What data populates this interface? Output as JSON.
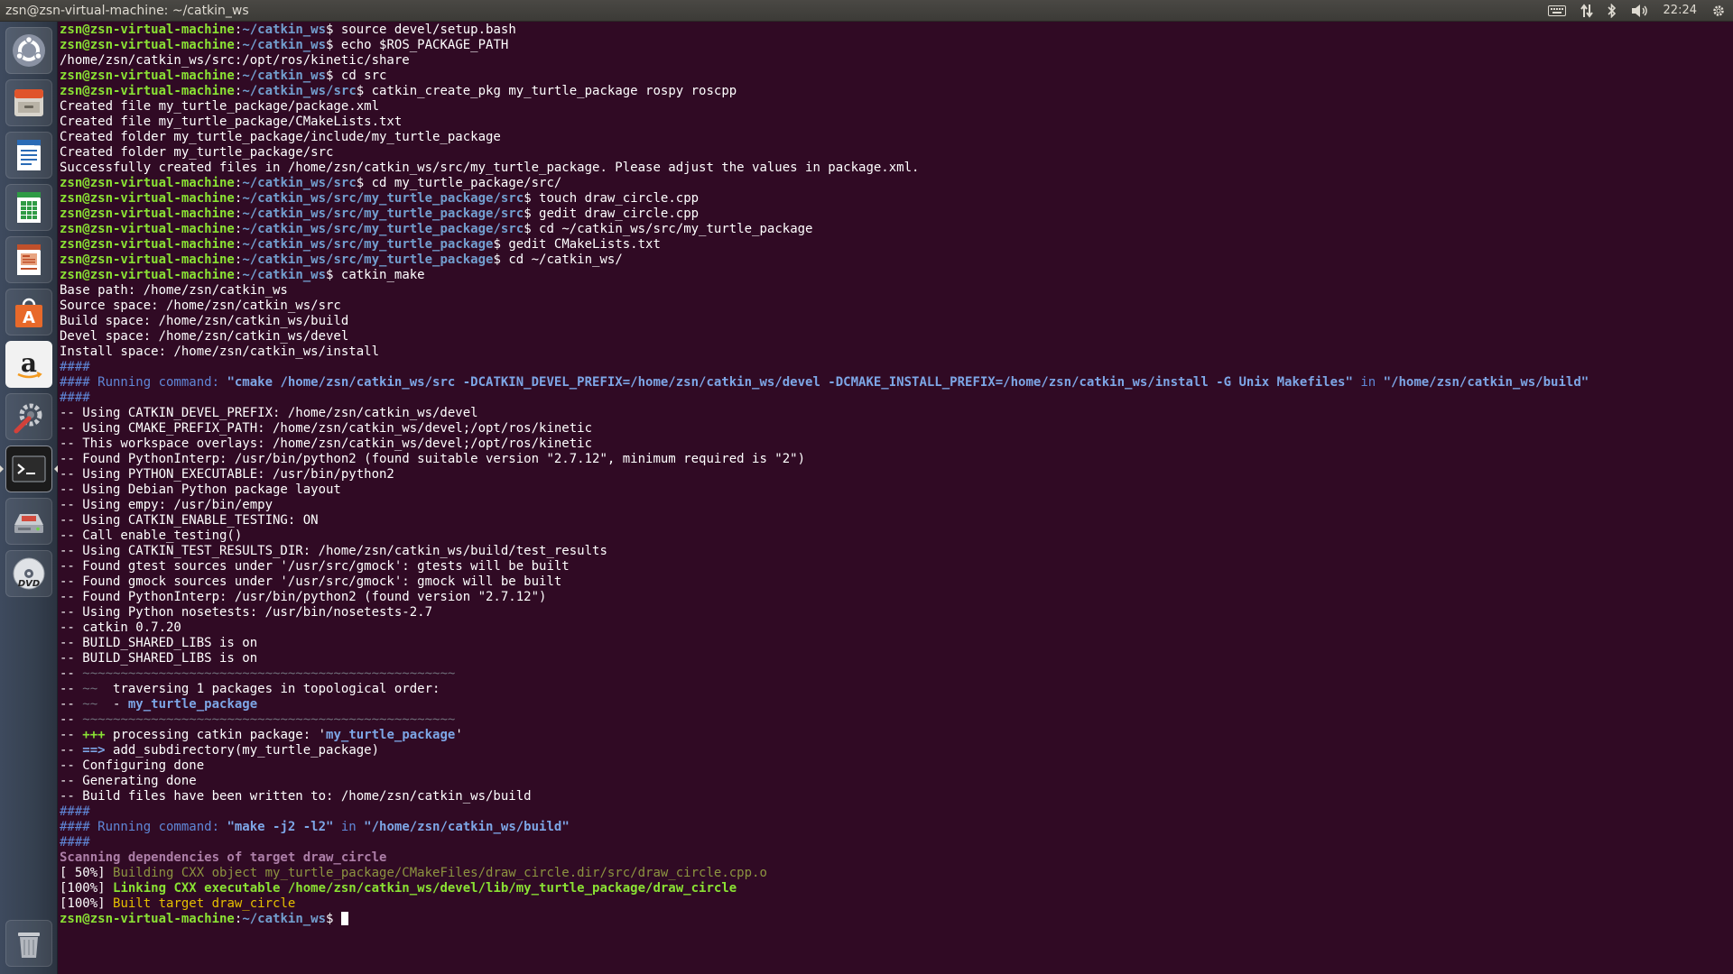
{
  "window": {
    "title": "zsn@zsn-virtual-machine: ~/catkin_ws"
  },
  "tray": {
    "icons": [
      "keyboard-icon",
      "network-icon",
      "bluetooth-icon",
      "volume-icon",
      "gear-icon"
    ],
    "clock": "22:24"
  },
  "launcher": {
    "items": [
      {
        "name": "dash-home",
        "icon": "ubuntu-logo-icon"
      },
      {
        "name": "files",
        "icon": "file-cabinet-icon"
      },
      {
        "name": "libreoffice-writer",
        "icon": "writer-document-icon"
      },
      {
        "name": "libreoffice-calc",
        "icon": "spreadsheet-icon"
      },
      {
        "name": "libreoffice-impress",
        "icon": "presentation-icon"
      },
      {
        "name": "ubuntu-software",
        "icon": "software-bag-icon"
      },
      {
        "name": "amazon",
        "icon": "amazon-icon"
      },
      {
        "name": "system-settings",
        "icon": "settings-tools-icon"
      },
      {
        "name": "terminal",
        "icon": "terminal-icon",
        "active": true
      },
      {
        "name": "disk-drive",
        "icon": "hard-drive-icon"
      },
      {
        "name": "dvd",
        "icon": "dvd-icon"
      },
      {
        "name": "trash",
        "icon": "trash-icon"
      }
    ]
  },
  "colors": {
    "background": "#300a24",
    "prompt_user": "#8ae234",
    "prompt_path": "#729fcf",
    "text": "#ffffff"
  },
  "terminal": {
    "lines": [
      [
        {
          "t": "zsn@zsn-virtual-machine",
          "c": "prompt-user"
        },
        {
          "t": ":",
          "c": ""
        },
        {
          "t": "~/catkin_ws",
          "c": "prompt-path"
        },
        {
          "t": "$ source devel/setup.bash",
          "c": ""
        }
      ],
      [
        {
          "t": "zsn@zsn-virtual-machine",
          "c": "prompt-user"
        },
        {
          "t": ":",
          "c": ""
        },
        {
          "t": "~/catkin_ws",
          "c": "prompt-path"
        },
        {
          "t": "$ echo $ROS_PACKAGE_PATH",
          "c": ""
        }
      ],
      [
        {
          "t": "/home/zsn/catkin_ws/src:/opt/ros/kinetic/share",
          "c": ""
        }
      ],
      [
        {
          "t": "zsn@zsn-virtual-machine",
          "c": "prompt-user"
        },
        {
          "t": ":",
          "c": ""
        },
        {
          "t": "~/catkin_ws",
          "c": "prompt-path"
        },
        {
          "t": "$ cd src",
          "c": ""
        }
      ],
      [
        {
          "t": "zsn@zsn-virtual-machine",
          "c": "prompt-user"
        },
        {
          "t": ":",
          "c": ""
        },
        {
          "t": "~/catkin_ws/src",
          "c": "prompt-path"
        },
        {
          "t": "$ catkin_create_pkg my_turtle_package rospy roscpp",
          "c": ""
        }
      ],
      [
        {
          "t": "Created file my_turtle_package/package.xml",
          "c": ""
        }
      ],
      [
        {
          "t": "Created file my_turtle_package/CMakeLists.txt",
          "c": ""
        }
      ],
      [
        {
          "t": "Created folder my_turtle_package/include/my_turtle_package",
          "c": ""
        }
      ],
      [
        {
          "t": "Created folder my_turtle_package/src",
          "c": ""
        }
      ],
      [
        {
          "t": "Successfully created files in /home/zsn/catkin_ws/src/my_turtle_package. Please adjust the values in package.xml.",
          "c": ""
        }
      ],
      [
        {
          "t": "zsn@zsn-virtual-machine",
          "c": "prompt-user"
        },
        {
          "t": ":",
          "c": ""
        },
        {
          "t": "~/catkin_ws/src",
          "c": "prompt-path"
        },
        {
          "t": "$ cd my_turtle_package/src/",
          "c": ""
        }
      ],
      [
        {
          "t": "zsn@zsn-virtual-machine",
          "c": "prompt-user"
        },
        {
          "t": ":",
          "c": ""
        },
        {
          "t": "~/catkin_ws/src/my_turtle_package/src",
          "c": "prompt-path"
        },
        {
          "t": "$ touch draw_circle.cpp",
          "c": ""
        }
      ],
      [
        {
          "t": "zsn@zsn-virtual-machine",
          "c": "prompt-user"
        },
        {
          "t": ":",
          "c": ""
        },
        {
          "t": "~/catkin_ws/src/my_turtle_package/src",
          "c": "prompt-path"
        },
        {
          "t": "$ gedit draw_circle.cpp",
          "c": ""
        }
      ],
      [
        {
          "t": "zsn@zsn-virtual-machine",
          "c": "prompt-user"
        },
        {
          "t": ":",
          "c": ""
        },
        {
          "t": "~/catkin_ws/src/my_turtle_package/src",
          "c": "prompt-path"
        },
        {
          "t": "$ cd ~/catkin_ws/src/my_turtle_package",
          "c": ""
        }
      ],
      [
        {
          "t": "zsn@zsn-virtual-machine",
          "c": "prompt-user"
        },
        {
          "t": ":",
          "c": ""
        },
        {
          "t": "~/catkin_ws/src/my_turtle_package",
          "c": "prompt-path"
        },
        {
          "t": "$ gedit CMakeLists.txt",
          "c": ""
        }
      ],
      [
        {
          "t": "zsn@zsn-virtual-machine",
          "c": "prompt-user"
        },
        {
          "t": ":",
          "c": ""
        },
        {
          "t": "~/catkin_ws/src/my_turtle_package",
          "c": "prompt-path"
        },
        {
          "t": "$ cd ~/catkin_ws/",
          "c": ""
        }
      ],
      [
        {
          "t": "zsn@zsn-virtual-machine",
          "c": "prompt-user"
        },
        {
          "t": ":",
          "c": ""
        },
        {
          "t": "~/catkin_ws",
          "c": "prompt-path"
        },
        {
          "t": "$ catkin_make",
          "c": ""
        }
      ],
      [
        {
          "t": "Base path: /home/zsn/catkin_ws",
          "c": ""
        }
      ],
      [
        {
          "t": "Source space: /home/zsn/catkin_ws/src",
          "c": ""
        }
      ],
      [
        {
          "t": "Build space: /home/zsn/catkin_ws/build",
          "c": ""
        }
      ],
      [
        {
          "t": "Devel space: /home/zsn/catkin_ws/devel",
          "c": ""
        }
      ],
      [
        {
          "t": "Install space: /home/zsn/catkin_ws/install",
          "c": ""
        }
      ],
      [
        {
          "t": "####",
          "c": "c-blue"
        }
      ],
      [
        {
          "t": "#### Running command: ",
          "c": "c-blue"
        },
        {
          "t": "\"cmake /home/zsn/catkin_ws/src -DCATKIN_DEVEL_PREFIX=/home/zsn/catkin_ws/devel -DCMAKE_INSTALL_PREFIX=/home/zsn/catkin_ws/install -G Unix Makefiles\"",
          "c": "c-blue-b"
        },
        {
          "t": " in ",
          "c": "c-blue"
        },
        {
          "t": "\"/home/zsn/catkin_ws/build\"",
          "c": "c-blue-b"
        }
      ],
      [
        {
          "t": "####",
          "c": "c-blue"
        }
      ],
      [
        {
          "t": "-- Using CATKIN_DEVEL_PREFIX: /home/zsn/catkin_ws/devel",
          "c": ""
        }
      ],
      [
        {
          "t": "-- Using CMAKE_PREFIX_PATH: /home/zsn/catkin_ws/devel;/opt/ros/kinetic",
          "c": ""
        }
      ],
      [
        {
          "t": "-- This workspace overlays: /home/zsn/catkin_ws/devel;/opt/ros/kinetic",
          "c": ""
        }
      ],
      [
        {
          "t": "-- Found PythonInterp: /usr/bin/python2 (found suitable version \"2.7.12\", minimum required is \"2\")",
          "c": ""
        }
      ],
      [
        {
          "t": "-- Using PYTHON_EXECUTABLE: /usr/bin/python2",
          "c": ""
        }
      ],
      [
        {
          "t": "-- Using Debian Python package layout",
          "c": ""
        }
      ],
      [
        {
          "t": "-- Using empy: /usr/bin/empy",
          "c": ""
        }
      ],
      [
        {
          "t": "-- Using CATKIN_ENABLE_TESTING: ON",
          "c": ""
        }
      ],
      [
        {
          "t": "-- Call enable_testing()",
          "c": ""
        }
      ],
      [
        {
          "t": "-- Using CATKIN_TEST_RESULTS_DIR: /home/zsn/catkin_ws/build/test_results",
          "c": ""
        }
      ],
      [
        {
          "t": "-- Found gtest sources under '/usr/src/gmock': gtests will be built",
          "c": ""
        }
      ],
      [
        {
          "t": "-- Found gmock sources under '/usr/src/gmock': gmock will be built",
          "c": ""
        }
      ],
      [
        {
          "t": "-- Found PythonInterp: /usr/bin/python2 (found version \"2.7.12\")",
          "c": ""
        }
      ],
      [
        {
          "t": "-- Using Python nosetests: /usr/bin/nosetests-2.7",
          "c": ""
        }
      ],
      [
        {
          "t": "-- catkin 0.7.20",
          "c": ""
        }
      ],
      [
        {
          "t": "-- BUILD_SHARED_LIBS is on",
          "c": ""
        }
      ],
      [
        {
          "t": "-- BUILD_SHARED_LIBS is on",
          "c": ""
        }
      ],
      [
        {
          "t": "-- ",
          "c": ""
        },
        {
          "t": "~~~~~~~~~~~~~~~~~~~~~~~~~~~~~~~~~~~~~~~~~~~~~~~~~",
          "c": "c-gray"
        }
      ],
      [
        {
          "t": "-- ",
          "c": ""
        },
        {
          "t": "~~",
          "c": "c-gray"
        },
        {
          "t": "  traversing 1 packages in topological order:",
          "c": ""
        }
      ],
      [
        {
          "t": "-- ",
          "c": ""
        },
        {
          "t": "~~",
          "c": "c-gray"
        },
        {
          "t": "  - ",
          "c": ""
        },
        {
          "t": "my_turtle_package",
          "c": "c-blue-b"
        }
      ],
      [
        {
          "t": "-- ",
          "c": ""
        },
        {
          "t": "~~~~~~~~~~~~~~~~~~~~~~~~~~~~~~~~~~~~~~~~~~~~~~~~~",
          "c": "c-gray"
        }
      ],
      [
        {
          "t": "-- ",
          "c": ""
        },
        {
          "t": "+++",
          "c": "c-green-b"
        },
        {
          "t": " processing catkin package: '",
          "c": ""
        },
        {
          "t": "my_turtle_package",
          "c": "c-blue-b"
        },
        {
          "t": "'",
          "c": ""
        }
      ],
      [
        {
          "t": "-- ",
          "c": ""
        },
        {
          "t": "==>",
          "c": "c-blue-b"
        },
        {
          "t": " add_subdirectory(my_turtle_package)",
          "c": ""
        }
      ],
      [
        {
          "t": "-- Configuring done",
          "c": ""
        }
      ],
      [
        {
          "t": "-- Generating done",
          "c": ""
        }
      ],
      [
        {
          "t": "-- Build files have been written to: /home/zsn/catkin_ws/build",
          "c": ""
        }
      ],
      [
        {
          "t": "####",
          "c": "c-blue"
        }
      ],
      [
        {
          "t": "#### Running command: ",
          "c": "c-blue"
        },
        {
          "t": "\"make -j2 -l2\"",
          "c": "c-blue-b"
        },
        {
          "t": " in ",
          "c": "c-blue"
        },
        {
          "t": "\"/home/zsn/catkin_ws/build\"",
          "c": "c-blue-b"
        }
      ],
      [
        {
          "t": "####",
          "c": "c-blue"
        }
      ],
      [
        {
          "t": "Scanning dependencies of target draw_circle",
          "c": "c-purple-b"
        }
      ],
      [
        {
          "t": "[ 50%] ",
          "c": ""
        },
        {
          "t": "Building CXX object my_turtle_package/CMakeFiles/draw_circle.dir/src/draw_circle.cpp.o",
          "c": "c-olive"
        }
      ],
      [
        {
          "t": "[100%] ",
          "c": ""
        },
        {
          "t": "Linking CXX executable /home/zsn/catkin_ws/devel/lib/my_turtle_package/draw_circle",
          "c": "c-lime-b"
        }
      ],
      [
        {
          "t": "[100%] ",
          "c": ""
        },
        {
          "t": "Built target draw_circle",
          "c": "c-yellow"
        }
      ],
      [
        {
          "t": "zsn@zsn-virtual-machine",
          "c": "prompt-user"
        },
        {
          "t": ":",
          "c": ""
        },
        {
          "t": "~/catkin_ws",
          "c": "prompt-path"
        },
        {
          "t": "$ ",
          "c": ""
        }
      ]
    ]
  }
}
